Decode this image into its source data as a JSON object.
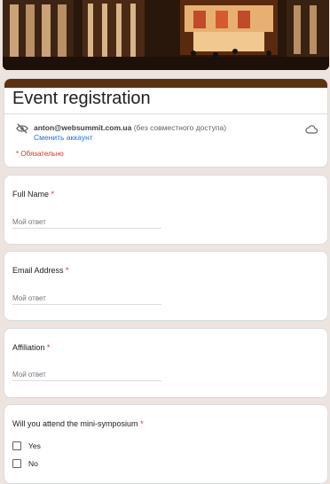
{
  "form": {
    "title": "Event registration",
    "account_email": "anton@websummit.com.ua",
    "account_note": "(без совместного доступа)",
    "switch_account": "Сменить аккаунт",
    "required_note": "* Обязательно"
  },
  "questions": [
    {
      "label": "Full Name",
      "required_mark": "*",
      "placeholder": "Мой ответ"
    },
    {
      "label": "Email Address",
      "required_mark": "*",
      "placeholder": "Мой ответ"
    },
    {
      "label": "Affiliation",
      "required_mark": "*",
      "placeholder": "Мой ответ"
    },
    {
      "label": "Will you attend the mini-symposium",
      "required_mark": "*",
      "options": [
        "Yes",
        "No"
      ]
    }
  ],
  "colors": {
    "accent": "#5b3210",
    "required": "#d93025",
    "link": "#1a73e8",
    "background": "#ede4df"
  },
  "icons": [
    "eye-off-icon",
    "cloud-icon"
  ]
}
